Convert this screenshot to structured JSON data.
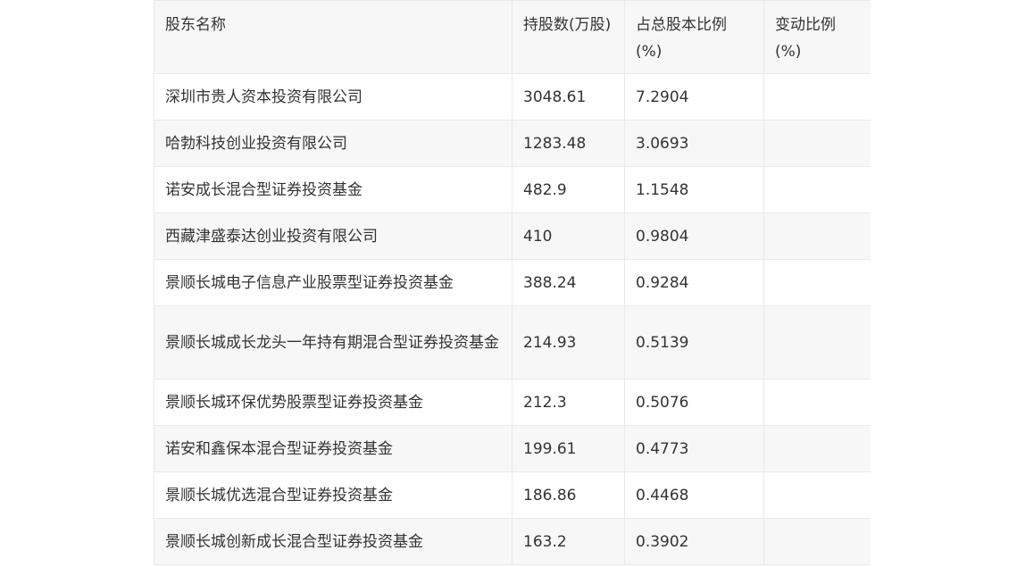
{
  "table": {
    "headers": [
      "股东名称",
      "持股数(万股)",
      "占总股本比例(%)",
      "变动比例(%)"
    ],
    "rows": [
      {
        "name": "深圳市贵人资本投资有限公司",
        "shares": "3048.61",
        "ratio": "7.2904",
        "change": ""
      },
      {
        "name": "哈勃科技创业投资有限公司",
        "shares": "1283.48",
        "ratio": "3.0693",
        "change": ""
      },
      {
        "name": "诺安成长混合型证券投资基金",
        "shares": "482.9",
        "ratio": "1.1548",
        "change": ""
      },
      {
        "name": "西藏津盛泰达创业投资有限公司",
        "shares": "410",
        "ratio": "0.9804",
        "change": ""
      },
      {
        "name": "景顺长城电子信息产业股票型证券投资基金",
        "shares": "388.24",
        "ratio": "0.9284",
        "change": ""
      },
      {
        "name": "景顺长城成长龙头一年持有期混合型证券投资基金",
        "shares": "214.93",
        "ratio": "0.5139",
        "change": ""
      },
      {
        "name": "景顺长城环保优势股票型证券投资基金",
        "shares": "212.3",
        "ratio": "0.5076",
        "change": ""
      },
      {
        "name": "诺安和鑫保本混合型证券投资基金",
        "shares": "199.61",
        "ratio": "0.4773",
        "change": ""
      },
      {
        "name": "景顺长城优选混合型证券投资基金",
        "shares": "186.86",
        "ratio": "0.4468",
        "change": ""
      },
      {
        "name": "景顺长城创新成长混合型证券投资基金",
        "shares": "163.2",
        "ratio": "0.3902",
        "change": ""
      }
    ]
  }
}
